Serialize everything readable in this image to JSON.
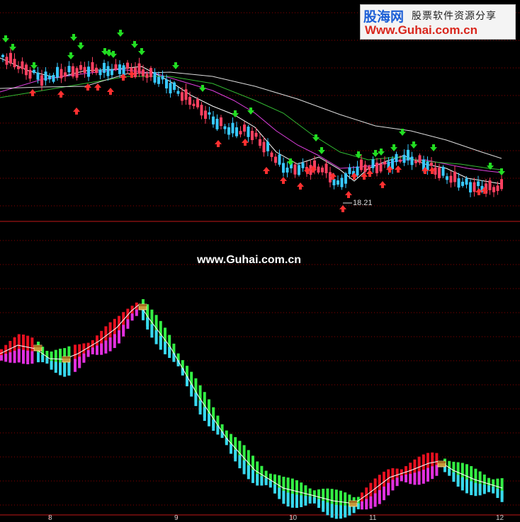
{
  "watermark": {
    "cn_name": "股海网",
    "slogan": "股票软件资源分享",
    "url": "Www.Guhai.com.cn"
  },
  "center_watermark": "www.Guhai.com.cn",
  "low_marker": "18.21",
  "month_labels": [
    "8",
    "9",
    "10",
    "11",
    "12"
  ],
  "colors": {
    "background": "#000000",
    "grid": "#8b0000",
    "candle_up": "#ff4060",
    "candle_down": "#37c8ff",
    "arrow_up": "#ff3030",
    "arrow_down": "#22dd22",
    "ma_short": "#ffffff",
    "ma_mid": "#e040e0",
    "ma_long": "#33bb33",
    "ma_slow": "#dddddd",
    "hist_red": "#e81020",
    "hist_magenta": "#e030e0",
    "hist_green": "#33ee44",
    "hist_cyan": "#38d8f0"
  },
  "icons": [
    "arrow-up-icon",
    "arrow-down-icon",
    "treasure-chest-icon"
  ],
  "chart_data": {
    "type": "candlestick-with-oscillator",
    "price_low_label": "18.21",
    "x_labels": [
      "8",
      "9",
      "10",
      "11",
      "12"
    ]
  }
}
